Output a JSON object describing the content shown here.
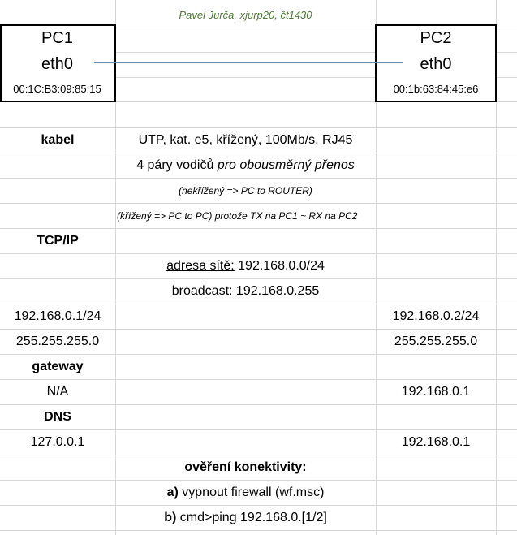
{
  "header": "Pavel Jurča, xjurp20, čt1430",
  "pc1": {
    "name": "PC1",
    "iface": "eth0",
    "mac": "00:1C:B3:09:85:15"
  },
  "pc2": {
    "name": "PC2",
    "iface": "eth0",
    "mac": "00:1b:63:84:45:e6"
  },
  "cable": {
    "label": "kabel",
    "spec": "UTP, kat. e5, křížený, 100Mb/s, RJ45",
    "pairs_prefix": "4 páry vodičů ",
    "pairs_italic": "pro obousměrný přenos",
    "note1": "(nekřížený => PC to ROUTER)",
    "note2": "(křížený => PC to PC) protože TX na PC1  ~ RX na PC2"
  },
  "tcpip": {
    "label": "TCP/IP",
    "net_label": "adresa sítě:",
    "net_value": " 192.168.0.0/24",
    "bc_label": "broadcast:",
    "bc_value": " 192.168.0.255"
  },
  "pc1_ip": "192.168.0.1/24",
  "pc1_mask": "255.255.255.0",
  "pc2_ip": "192.168.0.2/24",
  "pc2_mask": "255.255.255.0",
  "gateway": {
    "label": "gateway",
    "pc1": "N/A",
    "pc2": "192.168.0.1"
  },
  "dns": {
    "label": "DNS",
    "pc1": "127.0.0.1",
    "pc2": "192.168.0.1"
  },
  "verify": {
    "title": "ověření konektivity:",
    "a_prefix": "a)",
    "a_text": " vypnout firewall (wf.msc)",
    "b_prefix": "b)",
    "b_text": " cmd>ping 192.168.0.[1/2]"
  }
}
